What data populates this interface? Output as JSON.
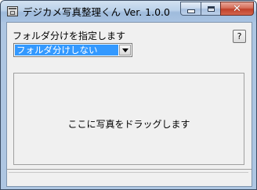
{
  "window": {
    "title": "デジカメ写真整理くん Ver. 1.0.0",
    "close_glyph": "✕"
  },
  "folder": {
    "label": "フォルダ分けを指定します",
    "help_label": "?",
    "selected_option": "フォルダ分けしない"
  },
  "dropzone": {
    "text": "ここに写真をドラッグします"
  },
  "statusbar": {
    "text": ""
  }
}
